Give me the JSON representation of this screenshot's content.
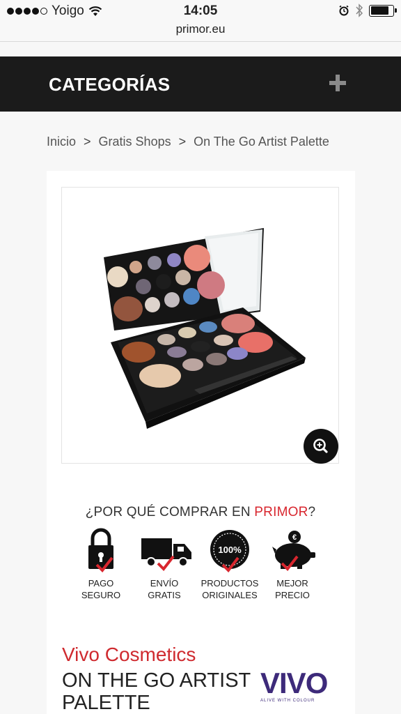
{
  "status_bar": {
    "carrier": "Yoigo",
    "time": "14:05",
    "url": "primor.eu",
    "signal_dots": 5,
    "signal_filled": 4,
    "battery_level": 0.82
  },
  "categories_bar": {
    "title": "CATEGORÍAS",
    "expand_icon": "plus-icon"
  },
  "breadcrumb": {
    "items": [
      "Inicio",
      "Gratis Shops",
      "On The Go Artist Palette"
    ],
    "separator": ">"
  },
  "product_image": {
    "zoom_icon": "zoom-in-icon"
  },
  "why_buy": {
    "prefix": "¿POR QUÉ COMPRAR EN ",
    "brand": "PRIMOR",
    "suffix": "?",
    "benefits": [
      {
        "icon": "padlock-icon",
        "line1": "PAGO",
        "line2": "SEGURO"
      },
      {
        "icon": "truck-icon",
        "line1": "ENVÍO",
        "line2": "GRATIS"
      },
      {
        "icon": "seal-100-icon",
        "badge": "100%",
        "line1": "PRODUCTOS",
        "line2": "ORIGINALES"
      },
      {
        "icon": "piggy-bank-icon",
        "line1": "MEJOR",
        "line2": "PRECIO"
      }
    ]
  },
  "product": {
    "brand": "Vivo Cosmetics",
    "name": "ON THE GO ARTIST PALETTE",
    "logo_text": "VIVO",
    "logo_tagline": "ALIVE WITH COLOUR"
  },
  "colors": {
    "accent_red": "#d8262e",
    "header_bg": "#1b1b1b",
    "vivo_purple": "#3d2a7a"
  }
}
